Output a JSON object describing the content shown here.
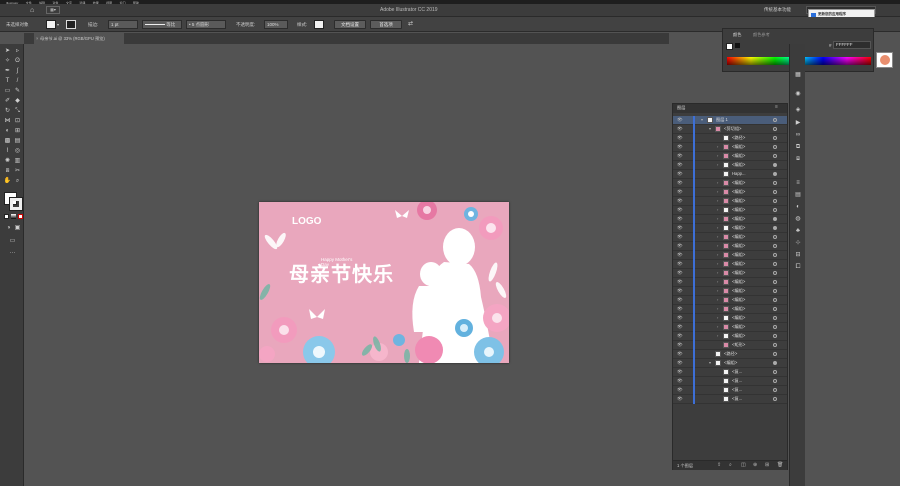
{
  "app": {
    "menus": [
      "Illustrator",
      "文件",
      "编辑",
      "对象",
      "文字",
      "选择",
      "效果",
      "视图",
      "窗口",
      "帮助"
    ],
    "title": "Adobe Illustrator CC 2019",
    "workspace": "传统基本功能",
    "search_placeholder": "搜索 Adobe Stock"
  },
  "control_bar": {
    "selection_label": "未选择对象",
    "stroke_label": "描边:",
    "stroke_weight": "1 pt",
    "line_style": "等比",
    "brush": "5 点圆形",
    "opacity_label": "不透明度:",
    "opacity_value": "100%",
    "style_label": "样式:",
    "doc_setup": "文档设置",
    "preferences": "首选项"
  },
  "document": {
    "tab_label": "母亲节.ai @ 33% (RGB/GPU 预览)"
  },
  "artboard": {
    "logo": "LOGO",
    "headline": "母亲节快乐",
    "english": "Happy Mother's Day"
  },
  "color_panel": {
    "tabs": [
      "颜色",
      "颜色参考"
    ],
    "hex_prefix": "#",
    "hex_value": "FFFFFF"
  },
  "notification": {
    "title": "更新您的应用程序",
    "body": "新版本的 Illustrator 可用"
  },
  "layers": {
    "tabs": [
      "图层"
    ],
    "footer": "1 个图层",
    "rows": [
      {
        "name": "图层 1",
        "level": 0,
        "arrow": "▾",
        "thumb": "white",
        "tgt": "open"
      },
      {
        "name": "<剪切组>",
        "level": 1,
        "arrow": "▾",
        "thumb": "pink",
        "tgt": "open"
      },
      {
        "name": "<路径>",
        "level": 2,
        "arrow": "",
        "thumb": "white",
        "tgt": "open"
      },
      {
        "name": "<编组>",
        "level": 2,
        "arrow": "›",
        "thumb": "pink",
        "tgt": "open"
      },
      {
        "name": "<编组>",
        "level": 2,
        "arrow": "›",
        "thumb": "pink",
        "tgt": "open"
      },
      {
        "name": "<编组>",
        "level": 2,
        "arrow": "›",
        "thumb": "white",
        "tgt": "filled"
      },
      {
        "name": "Happ...",
        "level": 2,
        "arrow": "",
        "thumb": "white",
        "tgt": "filled"
      },
      {
        "name": "<编组>",
        "level": 2,
        "arrow": "›",
        "thumb": "pink",
        "tgt": "open"
      },
      {
        "name": "<编组>",
        "level": 2,
        "arrow": "›",
        "thumb": "pink",
        "tgt": "open"
      },
      {
        "name": "<编组>",
        "level": 2,
        "arrow": "›",
        "thumb": "pink",
        "tgt": "open"
      },
      {
        "name": "<编组>",
        "level": 2,
        "arrow": "›",
        "thumb": "white",
        "tgt": "open"
      },
      {
        "name": "<编组>",
        "level": 2,
        "arrow": "›",
        "thumb": "pink",
        "tgt": "filled"
      },
      {
        "name": "<编组>",
        "level": 2,
        "arrow": "›",
        "thumb": "white",
        "tgt": "filled"
      },
      {
        "name": "<编组>",
        "level": 2,
        "arrow": "›",
        "thumb": "pink",
        "tgt": "open"
      },
      {
        "name": "<编组>",
        "level": 2,
        "arrow": "›",
        "thumb": "pink",
        "tgt": "open"
      },
      {
        "name": "<编组>",
        "level": 2,
        "arrow": "›",
        "thumb": "pink",
        "tgt": "open"
      },
      {
        "name": "<编组>",
        "level": 2,
        "arrow": "›",
        "thumb": "pink",
        "tgt": "open"
      },
      {
        "name": "<编组>",
        "level": 2,
        "arrow": "›",
        "thumb": "pink",
        "tgt": "open"
      },
      {
        "name": "<编组>",
        "level": 2,
        "arrow": "›",
        "thumb": "pink",
        "tgt": "open"
      },
      {
        "name": "<编组>",
        "level": 2,
        "arrow": "›",
        "thumb": "pink",
        "tgt": "open"
      },
      {
        "name": "<编组>",
        "level": 2,
        "arrow": "›",
        "thumb": "pink",
        "tgt": "open"
      },
      {
        "name": "<编组>",
        "level": 2,
        "arrow": "›",
        "thumb": "pink",
        "tgt": "open"
      },
      {
        "name": "<编组>",
        "level": 2,
        "arrow": "›",
        "thumb": "white",
        "tgt": "open"
      },
      {
        "name": "<编组>",
        "level": 2,
        "arrow": "›",
        "thumb": "pink",
        "tgt": "open"
      },
      {
        "name": "<编组>",
        "level": 2,
        "arrow": "›",
        "thumb": "white",
        "tgt": "open"
      },
      {
        "name": "<矩形>",
        "level": 2,
        "arrow": "",
        "thumb": "pink",
        "tgt": "open"
      },
      {
        "name": "<路径>",
        "level": 1,
        "arrow": "",
        "thumb": "white",
        "tgt": "open"
      },
      {
        "name": "<编组>",
        "level": 1,
        "arrow": "▾",
        "thumb": "white",
        "tgt": "filled"
      },
      {
        "name": "<复...",
        "level": 2,
        "arrow": "",
        "thumb": "white",
        "tgt": "open"
      },
      {
        "name": "<复...",
        "level": 2,
        "arrow": "",
        "thumb": "white",
        "tgt": "open"
      },
      {
        "name": "<复...",
        "level": 2,
        "arrow": "",
        "thumb": "white",
        "tgt": "open"
      },
      {
        "name": "<复...",
        "level": 2,
        "arrow": "",
        "thumb": "white",
        "tgt": "open"
      }
    ]
  }
}
